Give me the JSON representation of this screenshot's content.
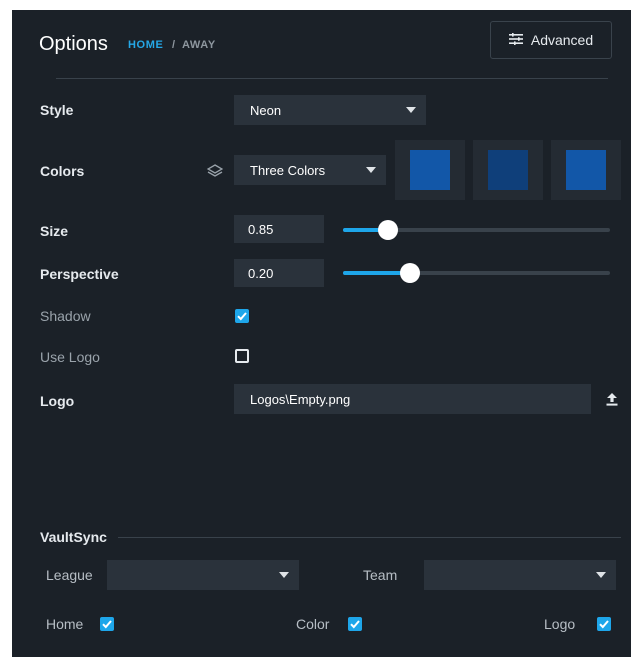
{
  "header": {
    "title": "Options",
    "breadcrumb": {
      "home": "HOME",
      "separator": "/",
      "away": "AWAY"
    },
    "advanced_button": {
      "icon": "sliders-icon",
      "label": "Advanced"
    }
  },
  "rows": {
    "style": {
      "label": "Style",
      "value": "Neon"
    },
    "colors": {
      "label": "Colors",
      "icon": "layers-icon",
      "value": "Three Colors",
      "swatches": [
        "#1257a8",
        "#0f3f7a",
        "#1257a8"
      ]
    },
    "size": {
      "label": "Size",
      "value": "0.85",
      "slider_fraction": 0.17
    },
    "perspective": {
      "label": "Perspective",
      "value": "0.20",
      "slider_fraction": 0.25
    },
    "shadow": {
      "label": "Shadow",
      "checked": true
    },
    "use_logo": {
      "label": "Use Logo",
      "checked": false
    },
    "logo": {
      "label": "Logo",
      "value": "Logos\\Empty.png",
      "icon": "upload-icon"
    }
  },
  "vaultsync": {
    "title": "VaultSync",
    "league": {
      "label": "League",
      "value": ""
    },
    "team": {
      "label": "Team",
      "value": ""
    },
    "home": {
      "label": "Home",
      "checked": true
    },
    "color": {
      "label": "Color",
      "checked": true
    },
    "logo": {
      "label": "Logo",
      "checked": true
    }
  },
  "colors": {
    "panel_bg": "#1b2128",
    "control_bg": "#2a323b",
    "accent": "#1ea6ea",
    "breadcrumb_active": "#25a7e6"
  }
}
